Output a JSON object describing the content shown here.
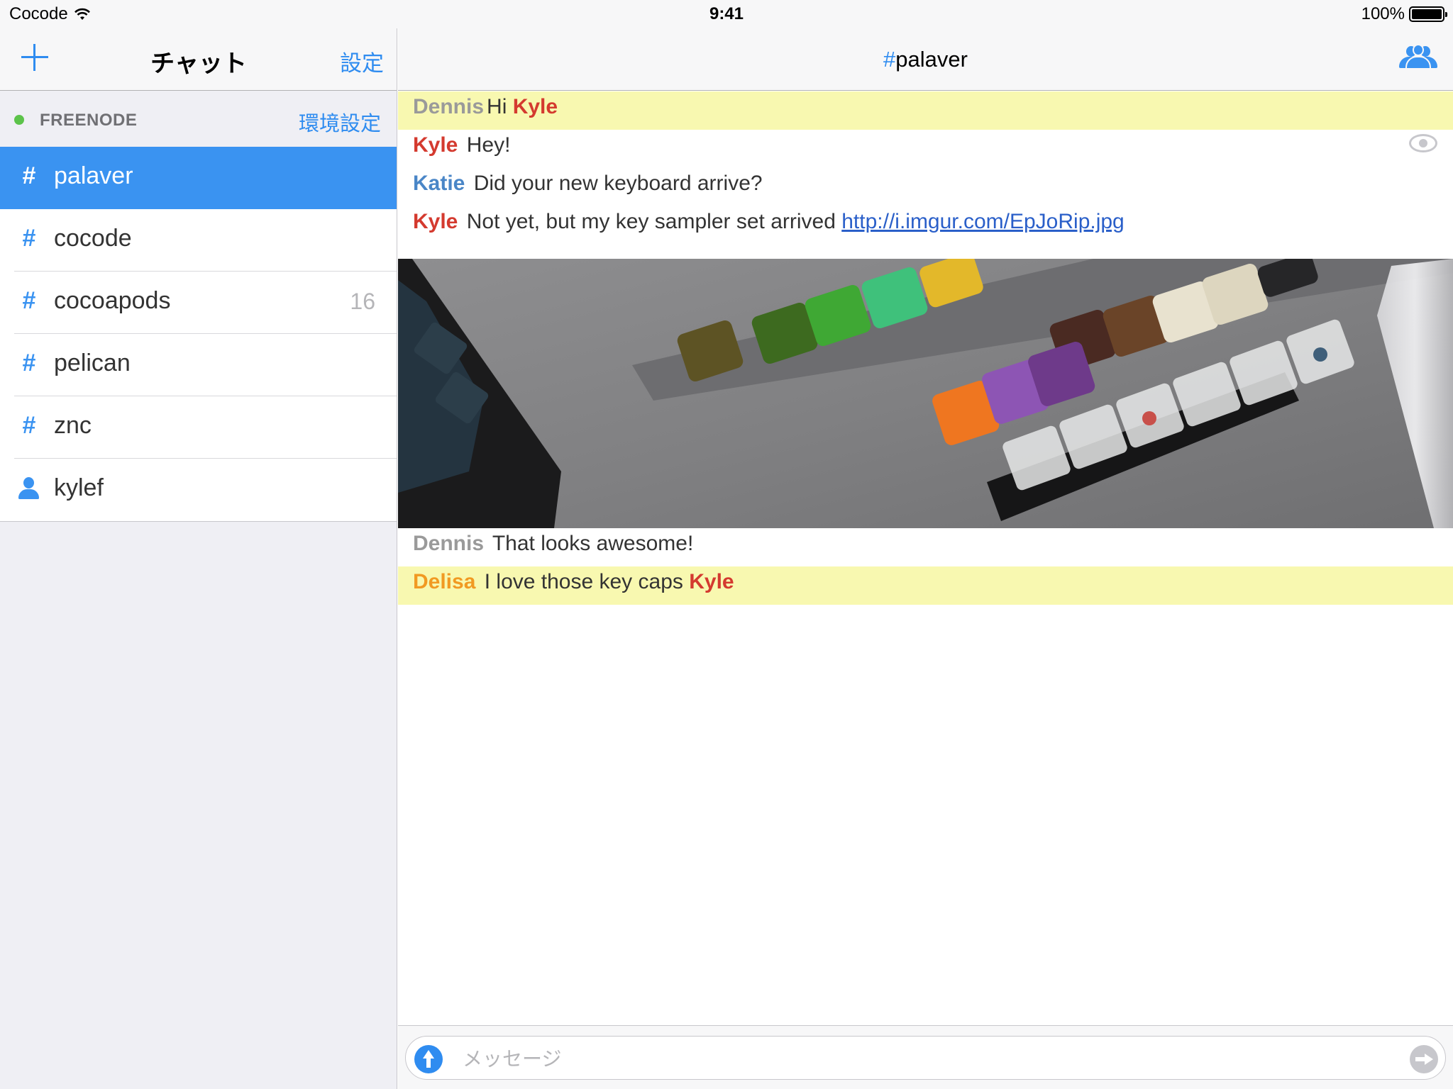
{
  "status_bar": {
    "carrier": "Cocode",
    "time": "9:41",
    "battery": "100%"
  },
  "sidebar": {
    "title": "チャット",
    "settings_label": "設定",
    "network": {
      "name": "FREENODE",
      "status_color": "#5cc34a",
      "prefs_label": "環境設定"
    },
    "channels": [
      {
        "type": "channel",
        "icon": "#",
        "name": "palaver",
        "badge": "",
        "selected": true
      },
      {
        "type": "channel",
        "icon": "#",
        "name": "cocode",
        "badge": "",
        "selected": false
      },
      {
        "type": "channel",
        "icon": "#",
        "name": "cocoapods",
        "badge": "16",
        "selected": false
      },
      {
        "type": "channel",
        "icon": "#",
        "name": "pelican",
        "badge": "",
        "selected": false
      },
      {
        "type": "channel",
        "icon": "#",
        "name": "znc",
        "badge": "",
        "selected": false
      },
      {
        "type": "query",
        "icon": "user-icon",
        "name": "kylef",
        "badge": "",
        "selected": false
      }
    ]
  },
  "chat": {
    "title_hash": "#",
    "title_name": "palaver",
    "messages": [
      {
        "nick": "Dennis",
        "parts": [
          "Hi "
        ],
        "mention": "Kyle",
        "highlight": true
      },
      {
        "nick": "Kyle",
        "text": "Hey!"
      },
      {
        "nick": "Katie",
        "text": "Did your new keyboard arrive?"
      },
      {
        "nick": "Kyle",
        "text": "Not yet, but my key sampler set arrived ",
        "link": "http://i.imgur.com/EpJoRip.jpg"
      },
      {
        "nick": "Dennis",
        "text": "That looks awesome!"
      },
      {
        "nick": "Delisa",
        "text": "I love those key caps ",
        "mention": "Kyle",
        "highlight": true
      }
    ],
    "highlight_color": "#f8f8b0"
  },
  "input": {
    "placeholder": "メッセージ"
  },
  "colors": {
    "accent": "#2f8cf0",
    "selected_row": "#3a93f1",
    "nick_dennis": "#9a9a9a",
    "nick_kyle": "#d43a2f",
    "nick_katie": "#4a86c7",
    "nick_delisa": "#f19a22"
  }
}
